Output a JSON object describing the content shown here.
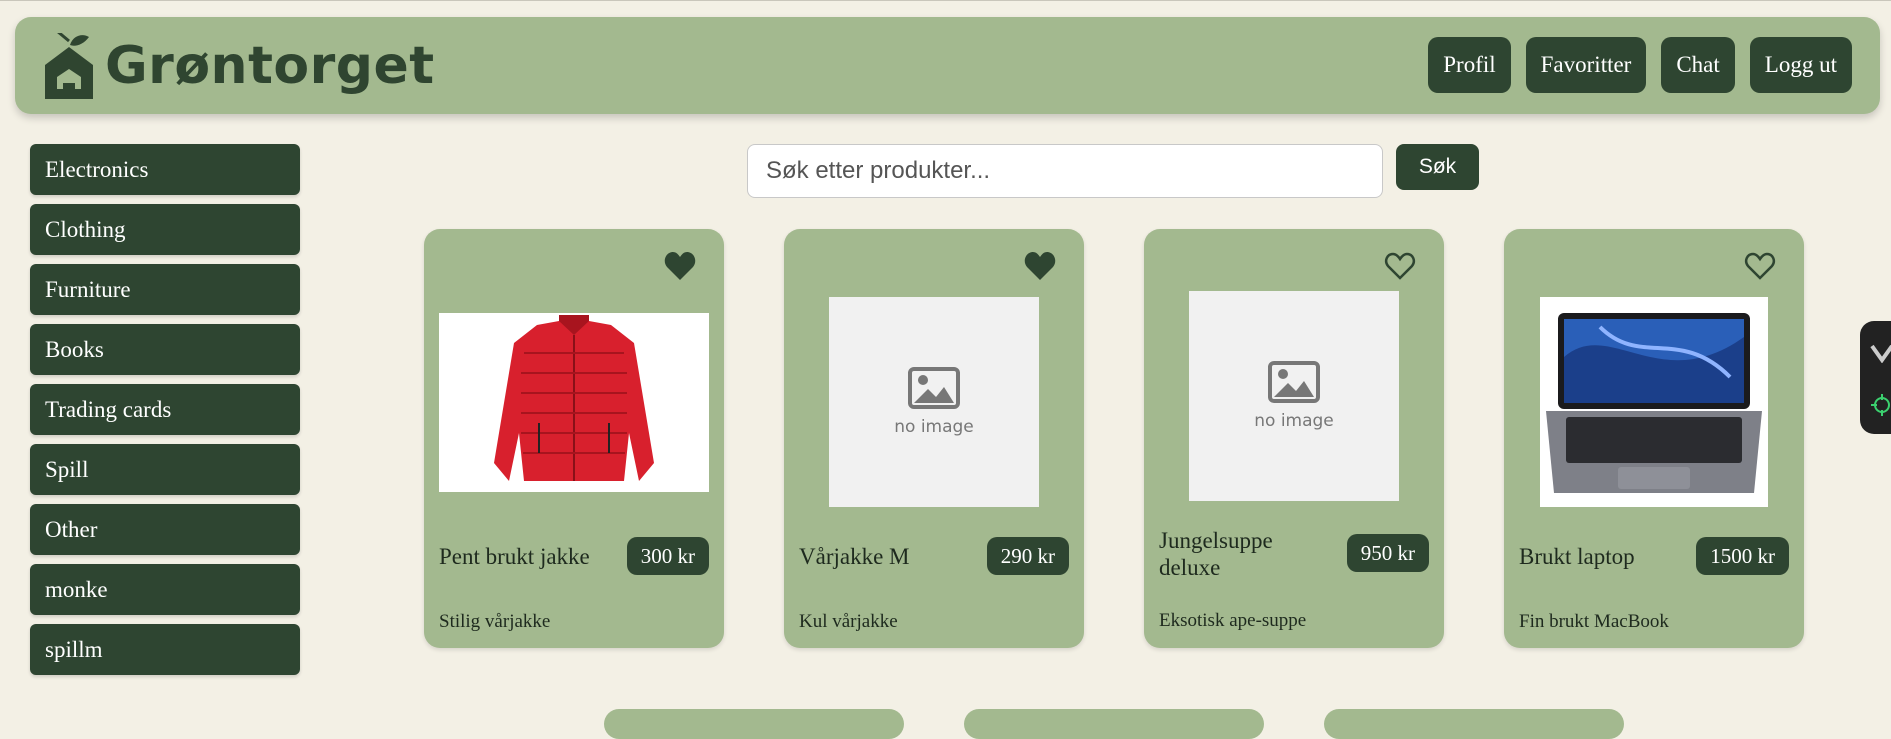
{
  "header": {
    "logo_text": "Grøntorget",
    "nav": [
      "Profil",
      "Favoritter",
      "Chat",
      "Logg ut"
    ]
  },
  "sidebar": {
    "categories": [
      "Electronics",
      "Clothing",
      "Furniture",
      "Books",
      "Trading cards",
      "Spill",
      "Other",
      "monke",
      "spillm"
    ]
  },
  "search": {
    "placeholder": "Søk etter produkter...",
    "button_label": "Søk"
  },
  "products": [
    {
      "title": "Pent brukt jakke",
      "price": "300 kr",
      "description": "Stilig vårjakke",
      "favorited": true,
      "image": "red-jacket"
    },
    {
      "title": "Vårjakke M",
      "price": "290 kr",
      "description": "Kul vårjakke",
      "favorited": true,
      "image": "no image"
    },
    {
      "title": "Jungelsuppe deluxe",
      "price": "950 kr",
      "description": "Eksotisk ape-suppe",
      "favorited": false,
      "image": "no image"
    },
    {
      "title": "Brukt laptop",
      "price": "1500 kr",
      "description": "Fin brukt MacBook",
      "favorited": false,
      "image": "macbook"
    }
  ],
  "colors": {
    "background": "#f3f0e5",
    "panel": "#a3b98f",
    "dark_green": "#2e4531"
  }
}
